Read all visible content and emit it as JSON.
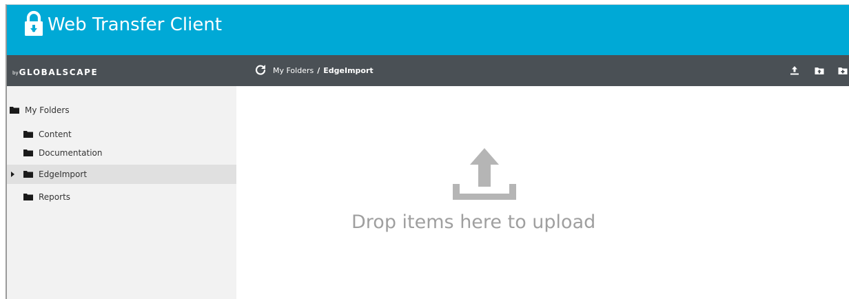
{
  "header": {
    "app_title": "Web Transfer Client",
    "lock_icon": "lock-icon"
  },
  "navbar": {
    "brand_prefix": "by",
    "brand_name": "GLOBALSCAPE",
    "refresh_icon": "refresh-icon",
    "breadcrumb": {
      "root": "My Folders",
      "separator": "/",
      "current": "EdgeImport"
    },
    "toolbar": {
      "upload_icon": "upload-icon",
      "upload_folder_icon": "upload-folder-icon",
      "new_folder_icon": "new-folder-icon"
    }
  },
  "sidebar": {
    "root_label": "My Folders",
    "items": [
      {
        "label": "Content",
        "selected": false,
        "expandable": false
      },
      {
        "label": "Documentation",
        "selected": false,
        "expandable": false
      },
      {
        "label": "EdgeImport",
        "selected": true,
        "expandable": true
      },
      {
        "label": "Reports",
        "selected": false,
        "expandable": false
      }
    ]
  },
  "dropzone": {
    "message": "Drop items here to upload",
    "icon": "upload-tray-icon"
  },
  "colors": {
    "header": "#00a9d6",
    "navbar": "#4a5055",
    "sidebar": "#f2f2f2",
    "selected_row": "#e0e0e0",
    "drop_text": "#9f9f9f",
    "drop_icon": "#b5b5b5"
  }
}
